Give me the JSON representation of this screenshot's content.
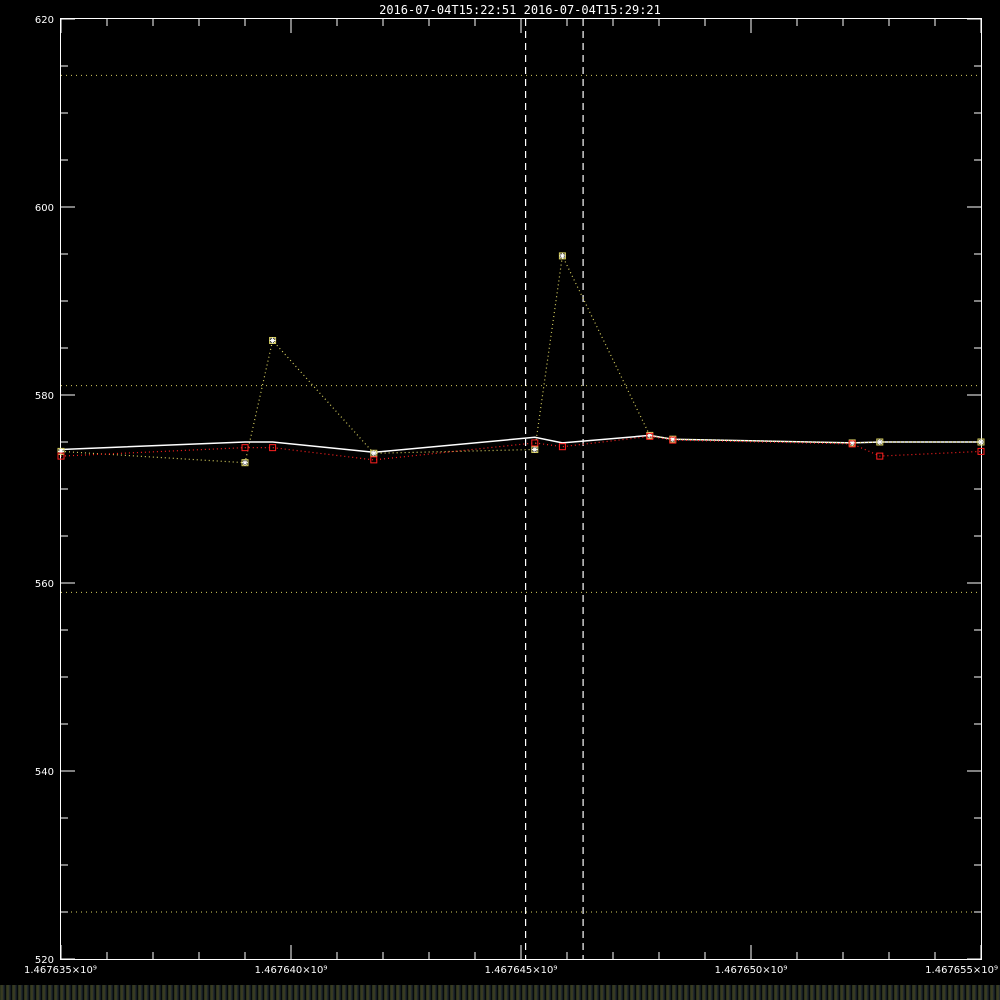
{
  "title": "2016-07-04T15:22:51  2016-07-04T15:29:21",
  "chart_data": {
    "type": "line",
    "x_ticks": [
      {
        "value": 1467635000,
        "label": "1.467635×10⁹"
      },
      {
        "value": 1467640000,
        "label": "1.467640×10⁹"
      },
      {
        "value": 1467645000,
        "label": "1.467645×10⁹"
      },
      {
        "value": 1467650000,
        "label": "1.467650×10⁹"
      },
      {
        "value": 1467655000,
        "label": "1.467655×10⁹"
      }
    ],
    "y_ticks": [
      {
        "value": 520,
        "label": "520"
      },
      {
        "value": 540,
        "label": "540"
      },
      {
        "value": 560,
        "label": "560"
      },
      {
        "value": 580,
        "label": "580"
      },
      {
        "value": 600,
        "label": "600"
      },
      {
        "value": 620,
        "label": "620"
      }
    ],
    "xlim": [
      1467635000,
      1467655000
    ],
    "ylim": [
      520,
      620
    ],
    "y_minor_step": 5,
    "x_minor_step": 1000,
    "hlines": [
      525,
      559,
      581,
      614
    ],
    "vlines": [
      1467645100,
      1467646350
    ],
    "series": [
      {
        "style": "white-solid",
        "color": "#ffffff",
        "x": [
          1467635000,
          1467639000,
          1467639600,
          1467641800,
          1467645300,
          1467645900,
          1467647800,
          1467648300,
          1467652200,
          1467652800,
          1467655000
        ],
        "y": [
          574.2,
          575.0,
          575.0,
          573.9,
          575.5,
          574.9,
          575.7,
          575.3,
          574.9,
          575.0,
          575.0
        ]
      },
      {
        "style": "yellow-dotted-asterisk",
        "color": "#d8d060",
        "x": [
          1467635000,
          1467639000,
          1467639600,
          1467641800,
          1467645300,
          1467645900,
          1467647800,
          1467648300,
          1467652200,
          1467652800,
          1467655000
        ],
        "y": [
          574.0,
          572.8,
          585.8,
          573.8,
          574.2,
          594.8,
          575.7,
          575.3,
          574.9,
          575.0,
          575.0
        ]
      },
      {
        "style": "red-dotted-square",
        "color": "#ff2020",
        "x": [
          1467635000,
          1467639000,
          1467639600,
          1467641800,
          1467645300,
          1467645900,
          1467647800,
          1467648300,
          1467652200,
          1467652800,
          1467655000
        ],
        "y": [
          573.5,
          574.4,
          574.4,
          573.1,
          574.9,
          574.5,
          575.6,
          575.2,
          574.8,
          573.5,
          574.0
        ]
      }
    ]
  }
}
